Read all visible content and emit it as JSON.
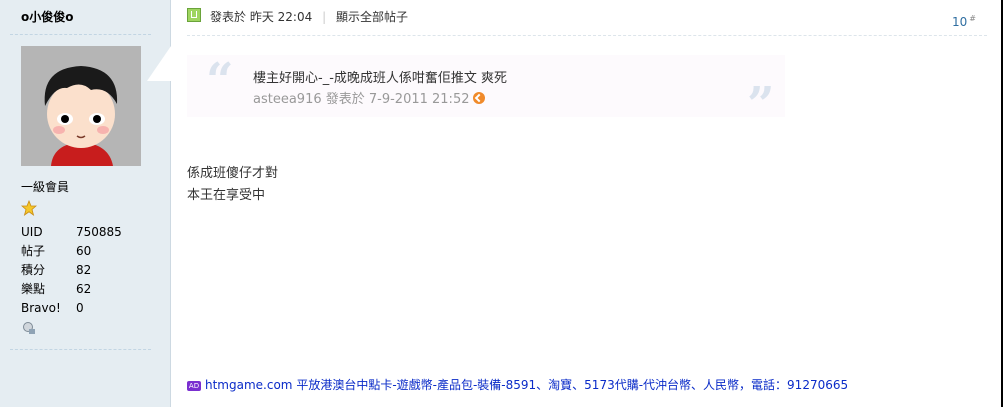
{
  "author": {
    "username": "o小俊俊o",
    "rank": "一級會員",
    "stats": [
      {
        "label": "UID",
        "value": "750885"
      },
      {
        "label": "帖子",
        "value": "60"
      },
      {
        "label": "積分",
        "value": "82"
      },
      {
        "label": "樂點",
        "value": "62"
      },
      {
        "label": "Bravo!",
        "value": "0"
      }
    ]
  },
  "post": {
    "posted_prefix": "發表於",
    "posted_time": "昨天 22:04",
    "show_all": "顯示全部帖子",
    "floor": "10",
    "floor_sup": "#",
    "quote": {
      "text": "樓主好開心-_-成晚成班人係咁奮佢推文 爽死",
      "author_line": "asteea916 發表於 7-9-2011 21:52"
    },
    "body_lines": [
      "係成班傻仔才對",
      "本王在享受中"
    ],
    "ad": {
      "badge": "AD",
      "site": "htmgame.com",
      "text": " 平放港澳台中點卡-遊戲幣-產品包-裝備-8591、淘寶、5173代購-代沖台幣、人民幣，電話：91270665"
    }
  },
  "colors": {
    "sidebar_bg": "#e5edf2",
    "floor_link": "#2f6ea1",
    "ad_link": "#0a2bc8",
    "online_green": "#9fd560"
  }
}
